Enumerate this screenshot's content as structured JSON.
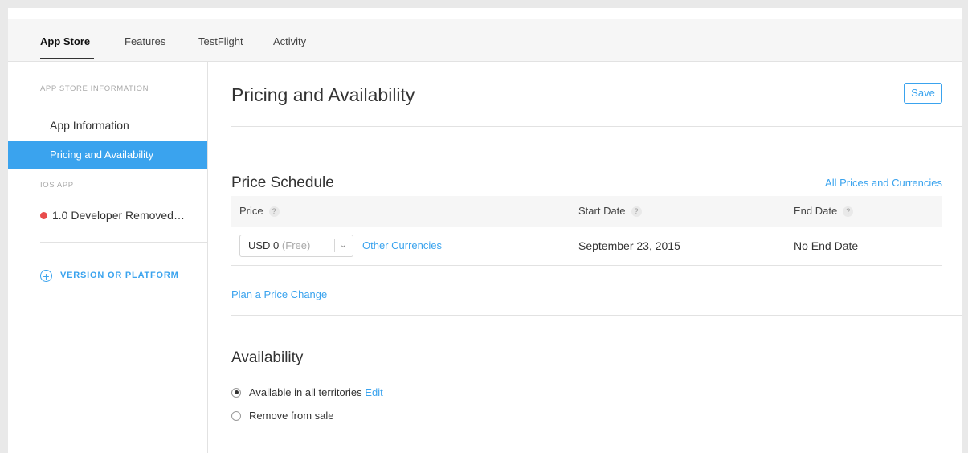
{
  "tabs": [
    {
      "label": "App Store",
      "active": true
    },
    {
      "label": "Features",
      "active": false
    },
    {
      "label": "TestFlight",
      "active": false
    },
    {
      "label": "Activity",
      "active": false
    }
  ],
  "sidebar": {
    "section1_heading": "APP STORE INFORMATION",
    "items": [
      {
        "label": "App Information",
        "active": false
      },
      {
        "label": "Pricing and Availability",
        "active": true
      }
    ],
    "section2_heading": "iOS APP",
    "version_label": "1.0 Developer Removed…",
    "version_status_color": "#e84c4c",
    "add_label": "VERSION OR PLATFORM"
  },
  "main": {
    "title": "Pricing and Availability",
    "save_label": "Save",
    "price_schedule": {
      "title": "Price Schedule",
      "all_prices_link": "All Prices and Currencies",
      "columns": [
        "Price",
        "Start Date",
        "End Date"
      ],
      "row": {
        "currency": "USD 0",
        "tier_note": "(Free)",
        "other_currencies": "Other Currencies",
        "start_date": "September 23, 2015",
        "end_date": "No End Date"
      },
      "plan_link": "Plan a Price Change"
    },
    "availability": {
      "title": "Availability",
      "options": [
        {
          "label": "Available in all territories",
          "checked": true,
          "edit": "Edit"
        },
        {
          "label": "Remove from sale",
          "checked": false
        }
      ]
    }
  },
  "colors": {
    "accent": "#3aa3ee",
    "nav_bg": "#f6f6f6",
    "divider": "#e2e2e2"
  }
}
